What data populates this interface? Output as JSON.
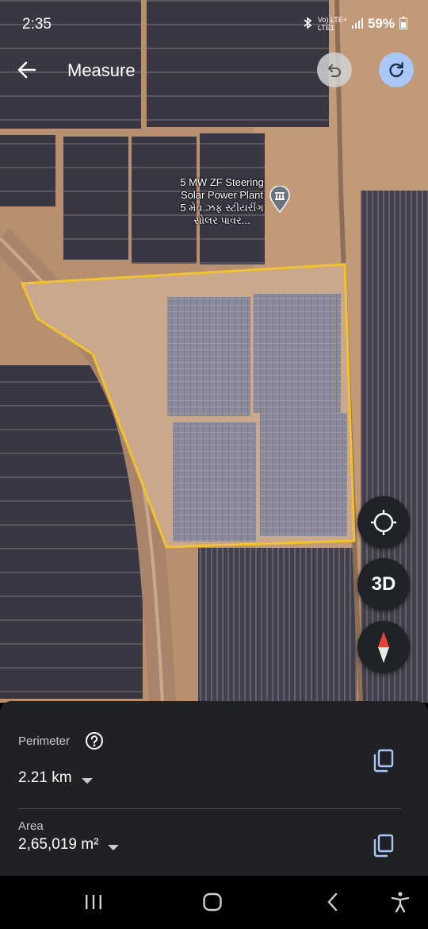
{
  "status_bar": {
    "time": "2:35",
    "network_top": "Vo) LTE+",
    "network_bottom": "LTE1",
    "battery": "59%"
  },
  "header": {
    "title": "Measure"
  },
  "map": {
    "place_label_lines": [
      "5 MW ZF Steering",
      "Solar Power Plant",
      "5 મેવ.ઝફ સ્ટીયરીંગ",
      "સોલર પાવર..."
    ],
    "outline_color": "#f2c230"
  },
  "controls": {
    "three_d_label": "3D"
  },
  "measurements": {
    "perimeter_label": "Perimeter",
    "perimeter_value": "2.21 km",
    "area_label": "Area",
    "area_value": "2,65,019 m²"
  },
  "colors": {
    "panel_bg": "#202124",
    "accent_blue": "#a9c8f7",
    "compass_red": "#e94235"
  }
}
